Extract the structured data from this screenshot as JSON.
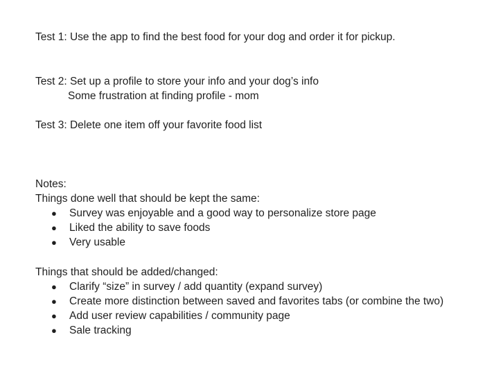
{
  "tests": [
    {
      "text": "Test 1: Use the app to find the best food for your dog and order it for pickup."
    },
    {
      "text": "Test 2: Set up a profile to store your info and your dog’s info",
      "note": "Some frustration at finding profile - mom"
    },
    {
      "text": "Test 3: Delete one item off your favorite food list"
    }
  ],
  "notes": {
    "heading": "Notes:",
    "kept": {
      "heading": "Things done well that should be kept the same:",
      "items": [
        "Survey was enjoyable and a good way to personalize store page",
        "Liked the ability to save foods",
        "Very usable"
      ]
    },
    "changed": {
      "heading": "Things that should be added/changed:",
      "items": [
        "Clarify “size” in survey / add quantity (expand survey)",
        "Create more distinction between saved and favorites tabs (or combine the two)",
        "Add user review capabilities / community page",
        "Sale tracking"
      ]
    }
  },
  "bullet_symbol": "●"
}
